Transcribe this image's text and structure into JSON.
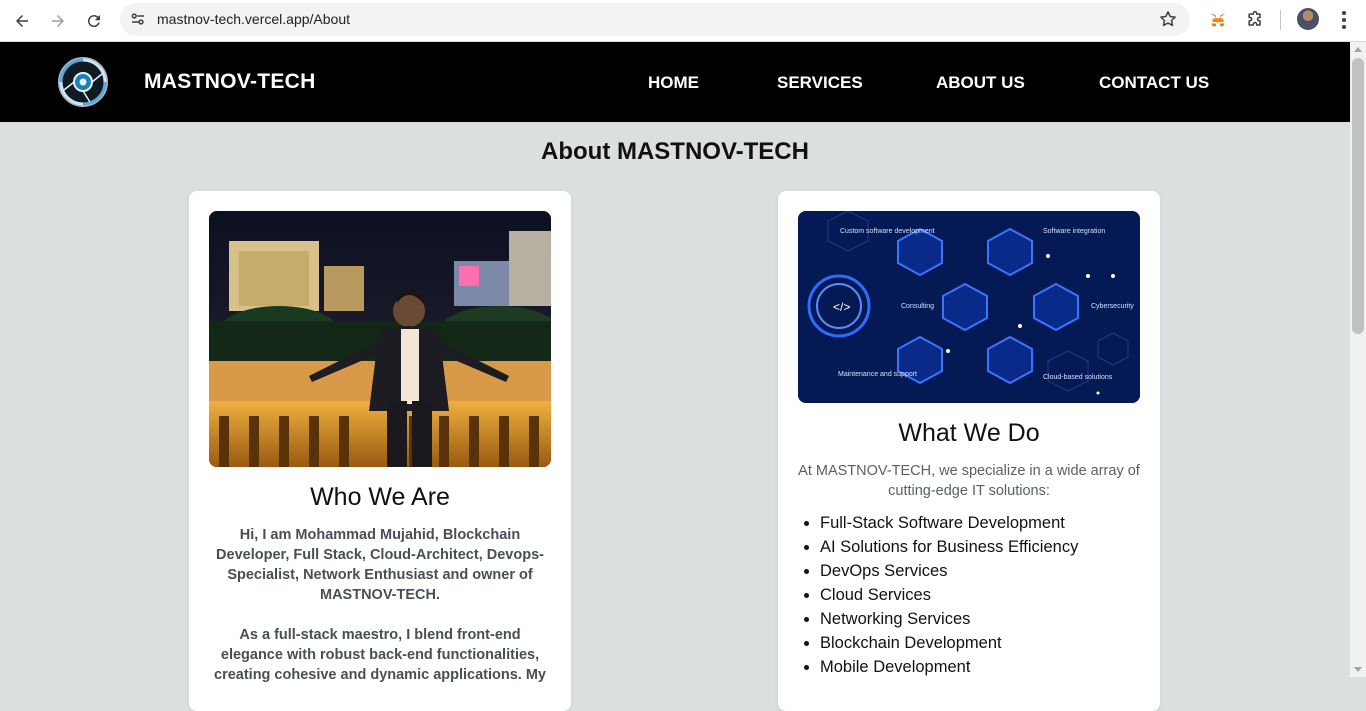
{
  "browser": {
    "url": "mastnov-tech.vercel.app/About"
  },
  "header": {
    "brand": "MASTNOV-TECH",
    "nav": [
      "HOME",
      "SERVICES",
      "ABOUT US",
      "CONTACT US"
    ]
  },
  "page": {
    "title": "About MASTNOV-TECH"
  },
  "who": {
    "title": "Who We Are",
    "p1": "Hi, I am Mohammad Mujahid, Blockchain Developer, Full Stack, Cloud-Architect, Devops-Specialist, Network Enthusiast and owner of MASTNOV-TECH.",
    "p2": "As a full-stack maestro, I blend front-end elegance with robust back-end functionalities, creating cohesive and dynamic applications. My"
  },
  "what": {
    "title": "What We Do",
    "intro": "At MASTNOV-TECH, we specialize in a wide array of cutting-edge IT solutions:",
    "services": [
      "Full-Stack Software Development",
      "AI Solutions for Business Efficiency",
      "DevOps Services",
      "Cloud Services",
      "Networking Services",
      "Blockchain Development",
      "Mobile Development"
    ],
    "image_labels": {
      "custom": "Custom software development",
      "integration": "Software integration",
      "consulting": "Consulting",
      "cyber": "Cybersecurity",
      "maintenance": "Maintenance and support",
      "cloud": "Cloud-based solutions"
    }
  }
}
